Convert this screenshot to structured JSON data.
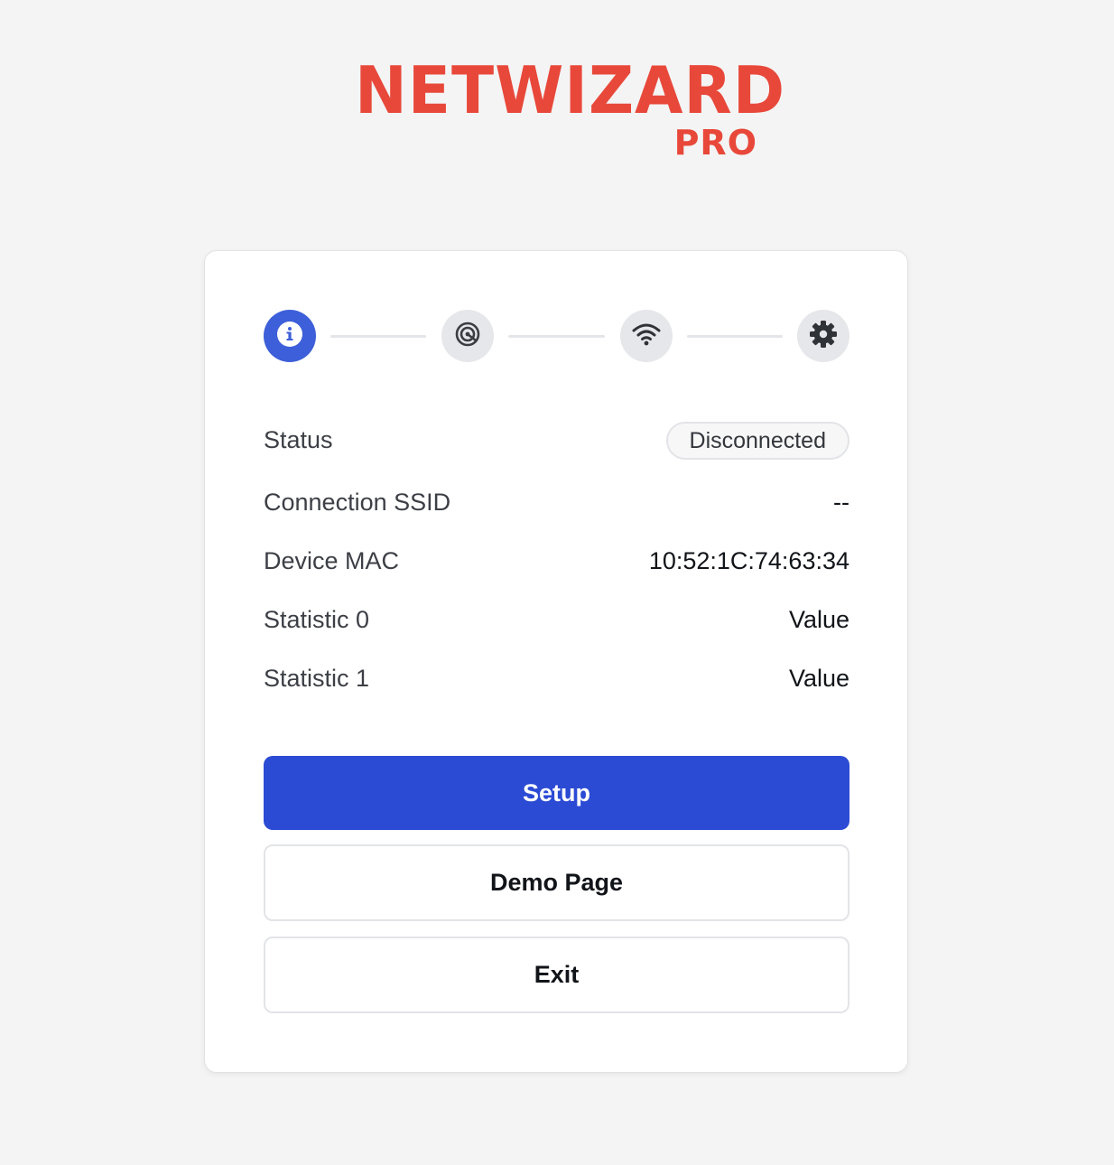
{
  "brand": {
    "name": "NETWIZARD",
    "edition": "PRO",
    "color": "#e8483a"
  },
  "stepper": {
    "steps": [
      {
        "icon": "info-icon",
        "active": true
      },
      {
        "icon": "target-icon",
        "active": false
      },
      {
        "icon": "wifi-icon",
        "active": false
      },
      {
        "icon": "gear-icon",
        "active": false
      }
    ],
    "active_color": "#3d5fd9"
  },
  "info": {
    "status_label": "Status",
    "status_value": "Disconnected",
    "ssid_label": "Connection SSID",
    "ssid_value": "--",
    "mac_label": "Device MAC",
    "mac_value": "10:52:1C:74:63:34",
    "stat0_label": "Statistic 0",
    "stat0_value": "Value",
    "stat1_label": "Statistic 1",
    "stat1_value": "Value"
  },
  "actions": {
    "setup_label": "Setup",
    "demo_label": "Demo Page",
    "exit_label": "Exit",
    "primary_color": "#2b4bd4"
  }
}
